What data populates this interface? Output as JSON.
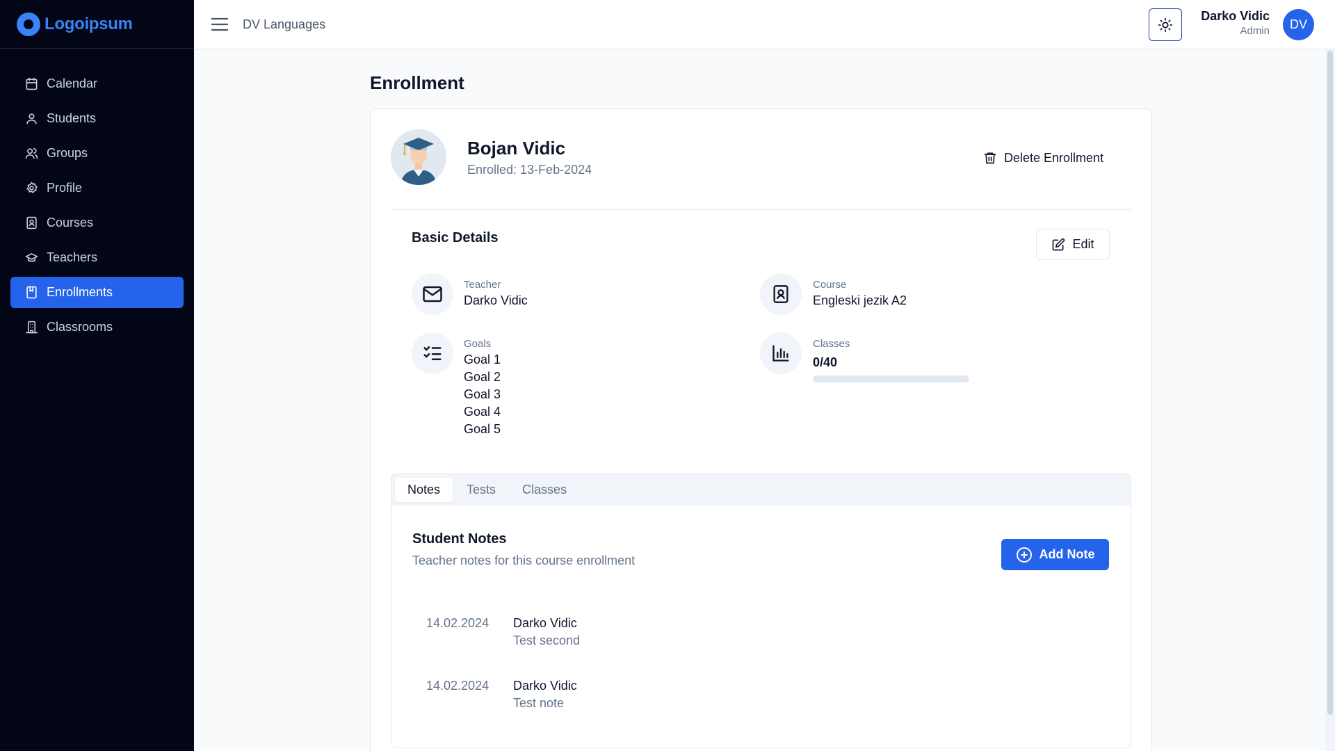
{
  "brand": {
    "logo_text": "Logoipsum",
    "accent": "#2563eb"
  },
  "sidebar": {
    "items": [
      {
        "label": "Calendar",
        "icon": "calendar-icon"
      },
      {
        "label": "Students",
        "icon": "user-icon"
      },
      {
        "label": "Groups",
        "icon": "users-icon"
      },
      {
        "label": "Profile",
        "icon": "gear-icon"
      },
      {
        "label": "Courses",
        "icon": "book-user-icon"
      },
      {
        "label": "Teachers",
        "icon": "graduation-cap-icon"
      },
      {
        "label": "Enrollments",
        "icon": "notebook-icon",
        "active": true
      },
      {
        "label": "Classrooms",
        "icon": "building-icon"
      }
    ]
  },
  "topbar": {
    "app_name": "DV Languages",
    "user_name": "Darko Vidic",
    "user_role": "Admin",
    "avatar_initials": "DV",
    "theme_icon": "sun-icon"
  },
  "page": {
    "title": "Enrollment"
  },
  "student": {
    "name": "Bojan Vidic",
    "enrolled": "Enrolled: 13-Feb-2024",
    "delete_label": "Delete Enrollment"
  },
  "details": {
    "title": "Basic Details",
    "edit_label": "Edit",
    "teacher_label": "Teacher",
    "teacher_value": "Darko Vidic",
    "course_label": "Course",
    "course_value": "Engleski jezik A2",
    "goals_label": "Goals",
    "goals": [
      "Goal 1",
      "Goal 2",
      "Goal 3",
      "Goal 4",
      "Goal 5"
    ],
    "classes_label": "Classes",
    "classes_value": "0/40",
    "classes_progress": 0
  },
  "tabs": [
    {
      "label": "Notes",
      "active": true
    },
    {
      "label": "Tests"
    },
    {
      "label": "Classes"
    }
  ],
  "notes": {
    "title": "Student Notes",
    "subtitle": "Teacher notes for this course enrollment",
    "add_label": "Add Note",
    "items": [
      {
        "date": "14.02.2024",
        "author": "Darko Vidic",
        "text": "Test second"
      },
      {
        "date": "14.02.2024",
        "author": "Darko Vidic",
        "text": "Test note"
      }
    ]
  }
}
